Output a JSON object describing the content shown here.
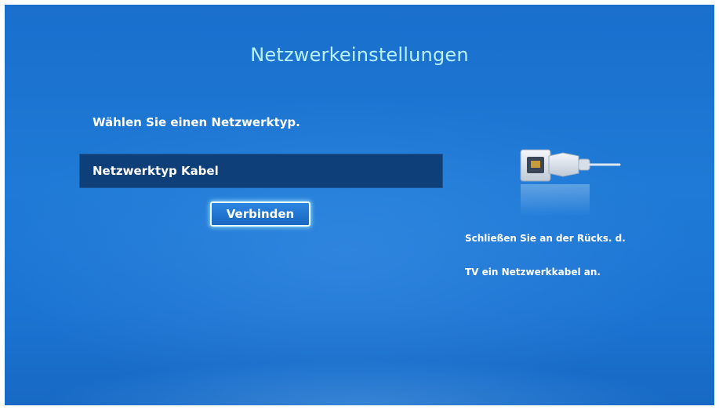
{
  "screen": {
    "title": "Netzwerkeinstellungen",
    "prompt": "Wählen Sie einen Netzwerktyp.",
    "network_type_label": "Netzwerktyp Kabel",
    "connect_label": "Verbinden",
    "hint_line_1": "Schließen Sie an der Rücks. d.",
    "hint_line_2": "TV ein Netzwerkkabel an."
  },
  "colors": {
    "background": "#1e7ad6",
    "title": "#b9f1ff",
    "selected_row": "#0f3f78",
    "text": "#ffffff"
  },
  "icons": {
    "illustration": "network-cable-icon"
  }
}
